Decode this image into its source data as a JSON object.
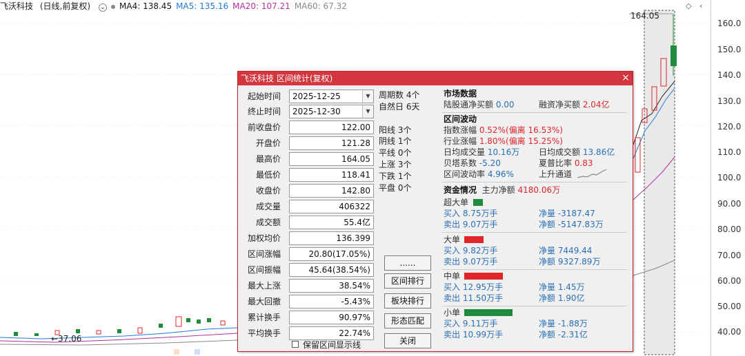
{
  "chart": {
    "stock_name": "飞沃科技",
    "period": "(日线,前复权)",
    "ma4": "MA4: 138.45",
    "ma5": "MA5: 135.16",
    "ma20": "MA20: 107.21",
    "ma60": "MA60: 67.32",
    "high_marker": "164.05",
    "low_marker": "←37.06",
    "y_axis": [
      "160.0",
      "150.0",
      "140.0",
      "130.0",
      "120.0",
      "110.0",
      "100.0",
      "90.00",
      "80.00",
      "70.00",
      "60.00",
      "50.00",
      "40.00"
    ],
    "colors": {
      "up": "#e0252b",
      "down": "#1e8c3a",
      "ma5": "#1e7bd8",
      "ma20": "#b1309b",
      "ma60": "#888888"
    }
  },
  "dialog": {
    "title": "飞沃科技 区间统计(复权)",
    "close_icon": "×",
    "start_label": "起始时间",
    "start_value": "2025-12-25",
    "end_label": "终止时间",
    "end_value": "2025-12-30",
    "fields": [
      {
        "label": "前收盘价",
        "value": "122.00"
      },
      {
        "label": "开盘价",
        "value": "121.28"
      },
      {
        "label": "最高价",
        "value": "164.05"
      },
      {
        "label": "最低价",
        "value": "118.41"
      },
      {
        "label": "收盘价",
        "value": "142.80"
      },
      {
        "label": "成交量",
        "value": "406322"
      },
      {
        "label": "成交额",
        "value": "55.4亿"
      },
      {
        "label": "加权均价",
        "value": "136.399"
      },
      {
        "label": "区间涨幅",
        "value": "20.80(17.05%)"
      },
      {
        "label": "区间振幅",
        "value": "45.64(38.54%)"
      },
      {
        "label": "最大上涨",
        "value": "38.54%"
      },
      {
        "label": "最大回撤",
        "value": "-5.43%"
      },
      {
        "label": "累计换手",
        "value": "90.97%"
      },
      {
        "label": "平均换手",
        "value": "22.74%"
      }
    ],
    "show_line_label": "保留区间显示线",
    "period_count": "周期数 4个",
    "natural_days": "自然日 6天",
    "stats": [
      "阳线 3个",
      "阴线 1个",
      "平线 0个",
      "上涨 3个",
      "下跌 1个",
      "平盘 0个"
    ],
    "buttons": {
      "more": "......",
      "range_rank": "区间排行",
      "sector_rank": "板块排行",
      "pattern_match": "形态匹配",
      "close": "关闭"
    },
    "market": {
      "header": "市场数据",
      "hk_label": "陆股通净买额",
      "hk_value": "0.00",
      "margin_label": "融资净买额",
      "margin_value": "2.04亿"
    },
    "volatility": {
      "header": "区间波动",
      "index_label": "指数涨幅",
      "index_value": "0.52%",
      "index_dev_label": "(偏离",
      "index_dev_value": "16.53%)",
      "industry_label": "行业涨幅",
      "industry_value": "1.80%",
      "industry_dev_label": "(偏离",
      "industry_dev_value": "15.25%)",
      "avg_vol_label": "日均成交量",
      "avg_vol_value": "10.16万",
      "avg_amt_label": "日均成交额",
      "avg_amt_value": "13.86亿",
      "beta_label": "贝塔系数",
      "beta_value": "-5.20",
      "sharpe_label": "夏普比率",
      "sharpe_value": "0.83",
      "volatility_label": "区间波动率",
      "volatility_value": "4.96%",
      "channel_label": "上升通道"
    },
    "funds": {
      "header": "资金情况",
      "main_label": "主力净额",
      "main_value": "4180.06万",
      "groups": [
        {
          "name": "超大单",
          "color": "#1e8c3a",
          "buy": "买入 8.75万手",
          "sell": "卖出 9.07万手",
          "net": "净量 -3187.47",
          "netamt": "净额 -5147.83万"
        },
        {
          "name": "大单",
          "color": "#e0252b",
          "buy": "买入 9.82万手",
          "sell": "卖出 9.07万手",
          "net": "净量 7449.44",
          "netamt": "净额 9327.89万"
        },
        {
          "name": "中单",
          "color": "#e0252b",
          "buy": "买入 12.95万手",
          "sell": "卖出 11.50万手",
          "net": "净量 1.45万",
          "netamt": "净额 1.90亿"
        },
        {
          "name": "小单",
          "color": "#1e8c3a",
          "buy": "买入 9.11万手",
          "sell": "卖出 10.99万手",
          "net": "净量 -1.88万",
          "netamt": "净额 -2.31亿"
        }
      ]
    }
  }
}
